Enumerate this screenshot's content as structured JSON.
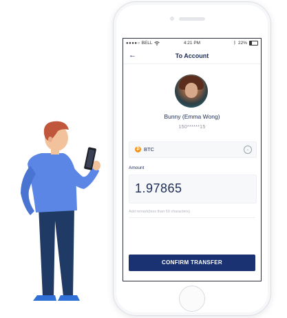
{
  "status_bar": {
    "carrier": "BELL",
    "time": "4:21 PM",
    "battery": "22%",
    "icons": [
      "signal-dots-icon",
      "wifi-icon",
      "bluetooth-icon",
      "battery-icon"
    ]
  },
  "header": {
    "back_icon": "arrow-left-icon",
    "title": "To Account"
  },
  "recipient": {
    "name": "Bunny (Emma Wong)",
    "account": "150******15"
  },
  "currency": {
    "code": "BTC",
    "coin_icon": "bitcoin-icon",
    "coin_symbol": "₿",
    "dropdown_icon": "chevron-down-icon",
    "coin_color": "#f7931a"
  },
  "amount": {
    "label": "Amount",
    "value": "1.97865"
  },
  "remark": {
    "placeholder": "Add remark(less than 50 characters)"
  },
  "actions": {
    "confirm_label": "CONFIRM TRANSFER",
    "confirm_color": "#1a3272"
  },
  "colors": {
    "primary_text": "#1a2a55",
    "muted_text": "#8a8f99"
  }
}
